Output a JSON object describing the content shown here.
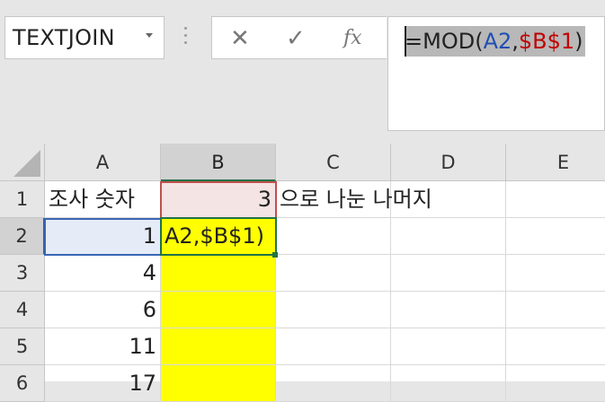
{
  "namebox": {
    "value": "TEXTJOIN"
  },
  "formula_buttons": {
    "cancel": "✕",
    "enter": "✓",
    "fx": "fx"
  },
  "formula_bar": {
    "parts": [
      {
        "text": "=MOD(",
        "color": "#222222"
      },
      {
        "text": "A2",
        "color": "#1f4fb3"
      },
      {
        "text": ",",
        "color": "#222222"
      },
      {
        "text": "$B$1",
        "color": "#c00000"
      },
      {
        "text": ")",
        "color": "#222222"
      }
    ]
  },
  "columns": [
    "A",
    "B",
    "C",
    "D",
    "E"
  ],
  "rows": [
    "1",
    "2",
    "3",
    "4",
    "5",
    "6"
  ],
  "cells": {
    "a1": "조사 숫자",
    "b1": "3",
    "c1": "으로 나눈 나머지",
    "a2": "1",
    "b2": "A2,$B$1)",
    "a3": "4",
    "a4": "6",
    "a5": "11",
    "a6": "17"
  },
  "colors": {
    "selection_accent": "#217346",
    "highlight": "#ffff00",
    "ref_red": "#c0504d",
    "ref_blue": "#3a66b5"
  }
}
